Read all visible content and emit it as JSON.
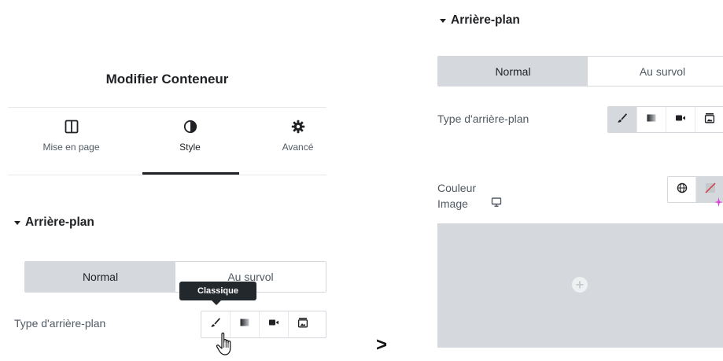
{
  "left": {
    "panel_title": "Modifier Conteneur",
    "tabs": [
      {
        "label": "Mise en page",
        "icon": "columns-icon"
      },
      {
        "label": "Style",
        "icon": "half-circle-icon"
      },
      {
        "label": "Avancé",
        "icon": "gear-icon"
      }
    ],
    "active_tab": "Style",
    "section_title": "Arrière-plan",
    "state_tabs": [
      "Normal",
      "Au survol"
    ],
    "background_type_label": "Type d'arrière-plan",
    "tooltip": "Classique"
  },
  "separator": ">",
  "right": {
    "section_title": "Arrière-plan",
    "state_tabs": [
      "Normal",
      "Au survol"
    ],
    "background_type_label": "Type d'arrière-plan",
    "color_label": "Couleur",
    "image_label": "Image"
  },
  "background_type_options": [
    "classic-brush-icon",
    "gradient-icon",
    "video-icon",
    "slideshow-icon"
  ],
  "colors": {
    "accent_pink": "#e040d8",
    "active_gray": "#d5d8dc",
    "text_dark": "#1f2124",
    "text_muted": "#515962"
  }
}
